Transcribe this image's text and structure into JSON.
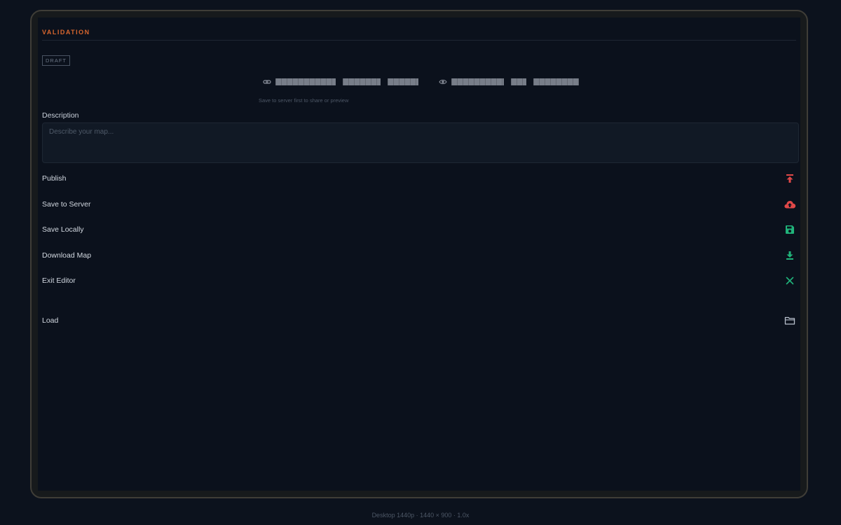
{
  "section": {
    "title": "VALIDATION",
    "status_badge": "DRAFT"
  },
  "share": {
    "link_icon": "link-icon",
    "preview_icon": "eye-icon",
    "hint": "Save to server first to share or preview"
  },
  "description": {
    "label": "Description",
    "placeholder": "Describe your map...",
    "value": ""
  },
  "actions": [
    {
      "label": "Publish",
      "icon": "publish-icon",
      "color": "#e04848"
    },
    {
      "label": "Save to Server",
      "icon": "cloud-upload-icon",
      "color": "#e04848"
    },
    {
      "label": "Save Locally",
      "icon": "save-icon",
      "color": "#20b37a"
    },
    {
      "label": "Download Map",
      "icon": "download-icon",
      "color": "#20b37a"
    },
    {
      "label": "Exit Editor",
      "icon": "close-icon",
      "color": "#20b37a"
    },
    {
      "label": "Load",
      "icon": "folder-icon",
      "color": "#b8c0cc"
    }
  ],
  "footer": {
    "device_info": "Desktop 1440p · 1440 × 900 · 1.0x"
  }
}
